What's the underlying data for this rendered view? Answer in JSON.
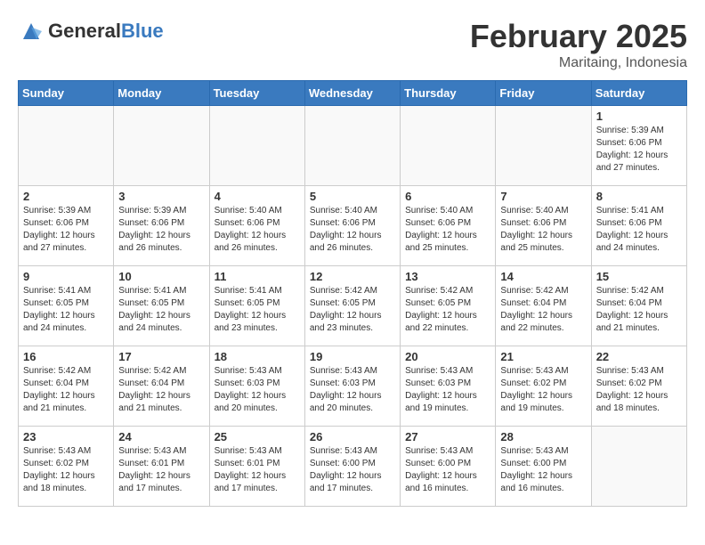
{
  "header": {
    "logo_general": "General",
    "logo_blue": "Blue",
    "month": "February 2025",
    "location": "Maritaing, Indonesia"
  },
  "weekdays": [
    "Sunday",
    "Monday",
    "Tuesday",
    "Wednesday",
    "Thursday",
    "Friday",
    "Saturday"
  ],
  "weeks": [
    [
      {
        "day": "",
        "info": ""
      },
      {
        "day": "",
        "info": ""
      },
      {
        "day": "",
        "info": ""
      },
      {
        "day": "",
        "info": ""
      },
      {
        "day": "",
        "info": ""
      },
      {
        "day": "",
        "info": ""
      },
      {
        "day": "1",
        "info": "Sunrise: 5:39 AM\nSunset: 6:06 PM\nDaylight: 12 hours\nand 27 minutes."
      }
    ],
    [
      {
        "day": "2",
        "info": "Sunrise: 5:39 AM\nSunset: 6:06 PM\nDaylight: 12 hours\nand 27 minutes."
      },
      {
        "day": "3",
        "info": "Sunrise: 5:39 AM\nSunset: 6:06 PM\nDaylight: 12 hours\nand 26 minutes."
      },
      {
        "day": "4",
        "info": "Sunrise: 5:40 AM\nSunset: 6:06 PM\nDaylight: 12 hours\nand 26 minutes."
      },
      {
        "day": "5",
        "info": "Sunrise: 5:40 AM\nSunset: 6:06 PM\nDaylight: 12 hours\nand 26 minutes."
      },
      {
        "day": "6",
        "info": "Sunrise: 5:40 AM\nSunset: 6:06 PM\nDaylight: 12 hours\nand 25 minutes."
      },
      {
        "day": "7",
        "info": "Sunrise: 5:40 AM\nSunset: 6:06 PM\nDaylight: 12 hours\nand 25 minutes."
      },
      {
        "day": "8",
        "info": "Sunrise: 5:41 AM\nSunset: 6:06 PM\nDaylight: 12 hours\nand 24 minutes."
      }
    ],
    [
      {
        "day": "9",
        "info": "Sunrise: 5:41 AM\nSunset: 6:05 PM\nDaylight: 12 hours\nand 24 minutes."
      },
      {
        "day": "10",
        "info": "Sunrise: 5:41 AM\nSunset: 6:05 PM\nDaylight: 12 hours\nand 24 minutes."
      },
      {
        "day": "11",
        "info": "Sunrise: 5:41 AM\nSunset: 6:05 PM\nDaylight: 12 hours\nand 23 minutes."
      },
      {
        "day": "12",
        "info": "Sunrise: 5:42 AM\nSunset: 6:05 PM\nDaylight: 12 hours\nand 23 minutes."
      },
      {
        "day": "13",
        "info": "Sunrise: 5:42 AM\nSunset: 6:05 PM\nDaylight: 12 hours\nand 22 minutes."
      },
      {
        "day": "14",
        "info": "Sunrise: 5:42 AM\nSunset: 6:04 PM\nDaylight: 12 hours\nand 22 minutes."
      },
      {
        "day": "15",
        "info": "Sunrise: 5:42 AM\nSunset: 6:04 PM\nDaylight: 12 hours\nand 21 minutes."
      }
    ],
    [
      {
        "day": "16",
        "info": "Sunrise: 5:42 AM\nSunset: 6:04 PM\nDaylight: 12 hours\nand 21 minutes."
      },
      {
        "day": "17",
        "info": "Sunrise: 5:42 AM\nSunset: 6:04 PM\nDaylight: 12 hours\nand 21 minutes."
      },
      {
        "day": "18",
        "info": "Sunrise: 5:43 AM\nSunset: 6:03 PM\nDaylight: 12 hours\nand 20 minutes."
      },
      {
        "day": "19",
        "info": "Sunrise: 5:43 AM\nSunset: 6:03 PM\nDaylight: 12 hours\nand 20 minutes."
      },
      {
        "day": "20",
        "info": "Sunrise: 5:43 AM\nSunset: 6:03 PM\nDaylight: 12 hours\nand 19 minutes."
      },
      {
        "day": "21",
        "info": "Sunrise: 5:43 AM\nSunset: 6:02 PM\nDaylight: 12 hours\nand 19 minutes."
      },
      {
        "day": "22",
        "info": "Sunrise: 5:43 AM\nSunset: 6:02 PM\nDaylight: 12 hours\nand 18 minutes."
      }
    ],
    [
      {
        "day": "23",
        "info": "Sunrise: 5:43 AM\nSunset: 6:02 PM\nDaylight: 12 hours\nand 18 minutes."
      },
      {
        "day": "24",
        "info": "Sunrise: 5:43 AM\nSunset: 6:01 PM\nDaylight: 12 hours\nand 17 minutes."
      },
      {
        "day": "25",
        "info": "Sunrise: 5:43 AM\nSunset: 6:01 PM\nDaylight: 12 hours\nand 17 minutes."
      },
      {
        "day": "26",
        "info": "Sunrise: 5:43 AM\nSunset: 6:00 PM\nDaylight: 12 hours\nand 17 minutes."
      },
      {
        "day": "27",
        "info": "Sunrise: 5:43 AM\nSunset: 6:00 PM\nDaylight: 12 hours\nand 16 minutes."
      },
      {
        "day": "28",
        "info": "Sunrise: 5:43 AM\nSunset: 6:00 PM\nDaylight: 12 hours\nand 16 minutes."
      },
      {
        "day": "",
        "info": ""
      }
    ]
  ]
}
